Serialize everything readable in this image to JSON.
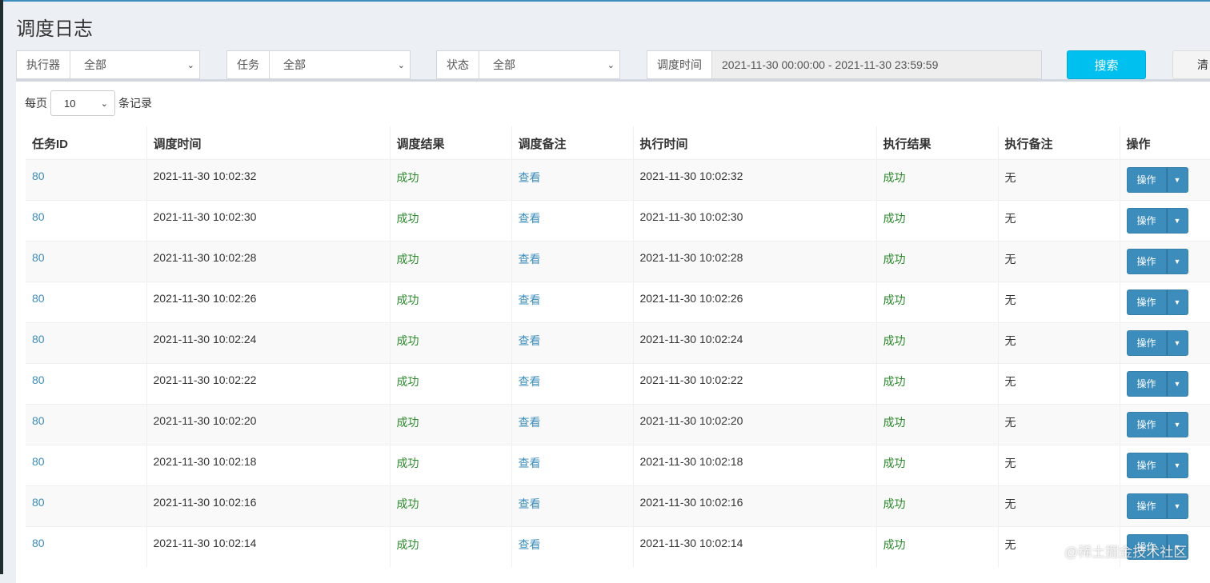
{
  "title": "调度日志",
  "filters": {
    "executor": {
      "label": "执行器",
      "value": "全部"
    },
    "job": {
      "label": "任务",
      "value": "全部"
    },
    "status": {
      "label": "状态",
      "value": "全部"
    },
    "time": {
      "label": "调度时间",
      "value": "2021-11-30 00:00:00 - 2021-11-30 23:59:59"
    },
    "search": "搜索",
    "clear": "清"
  },
  "page_length": {
    "prefix": "每页",
    "value": "10",
    "suffix": "条记录"
  },
  "columns": [
    "任务ID",
    "调度时间",
    "调度结果",
    "调度备注",
    "执行时间",
    "执行结果",
    "执行备注",
    "操作"
  ],
  "rows": [
    {
      "id": "80",
      "trigger_time": "2021-11-30 10:02:32",
      "trigger_result": "成功",
      "trigger_msg": "查看",
      "handle_time": "2021-11-30 10:02:32",
      "handle_result": "成功",
      "handle_msg": "无",
      "op": "操作"
    },
    {
      "id": "80",
      "trigger_time": "2021-11-30 10:02:30",
      "trigger_result": "成功",
      "trigger_msg": "查看",
      "handle_time": "2021-11-30 10:02:30",
      "handle_result": "成功",
      "handle_msg": "无",
      "op": "操作"
    },
    {
      "id": "80",
      "trigger_time": "2021-11-30 10:02:28",
      "trigger_result": "成功",
      "trigger_msg": "查看",
      "handle_time": "2021-11-30 10:02:28",
      "handle_result": "成功",
      "handle_msg": "无",
      "op": "操作"
    },
    {
      "id": "80",
      "trigger_time": "2021-11-30 10:02:26",
      "trigger_result": "成功",
      "trigger_msg": "查看",
      "handle_time": "2021-11-30 10:02:26",
      "handle_result": "成功",
      "handle_msg": "无",
      "op": "操作"
    },
    {
      "id": "80",
      "trigger_time": "2021-11-30 10:02:24",
      "trigger_result": "成功",
      "trigger_msg": "查看",
      "handle_time": "2021-11-30 10:02:24",
      "handle_result": "成功",
      "handle_msg": "无",
      "op": "操作"
    },
    {
      "id": "80",
      "trigger_time": "2021-11-30 10:02:22",
      "trigger_result": "成功",
      "trigger_msg": "查看",
      "handle_time": "2021-11-30 10:02:22",
      "handle_result": "成功",
      "handle_msg": "无",
      "op": "操作"
    },
    {
      "id": "80",
      "trigger_time": "2021-11-30 10:02:20",
      "trigger_result": "成功",
      "trigger_msg": "查看",
      "handle_time": "2021-11-30 10:02:20",
      "handle_result": "成功",
      "handle_msg": "无",
      "op": "操作"
    },
    {
      "id": "80",
      "trigger_time": "2021-11-30 10:02:18",
      "trigger_result": "成功",
      "trigger_msg": "查看",
      "handle_time": "2021-11-30 10:02:18",
      "handle_result": "成功",
      "handle_msg": "无",
      "op": "操作"
    },
    {
      "id": "80",
      "trigger_time": "2021-11-30 10:02:16",
      "trigger_result": "成功",
      "trigger_msg": "查看",
      "handle_time": "2021-11-30 10:02:16",
      "handle_result": "成功",
      "handle_msg": "无",
      "op": "操作"
    },
    {
      "id": "80",
      "trigger_time": "2021-11-30 10:02:14",
      "trigger_result": "成功",
      "trigger_msg": "查看",
      "handle_time": "2021-11-30 10:02:14",
      "handle_result": "成功",
      "handle_msg": "无",
      "op": "操作"
    }
  ],
  "watermark": "@稀土掘金技术社区"
}
